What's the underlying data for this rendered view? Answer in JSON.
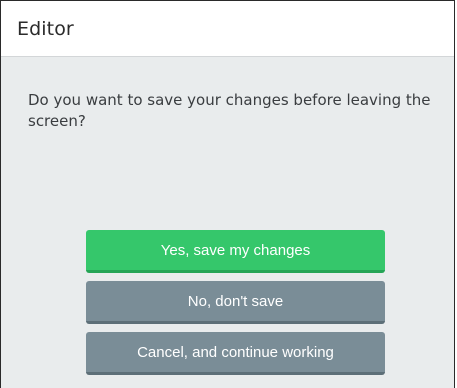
{
  "dialog": {
    "title": "Editor",
    "message": "Do you want to save your changes before leaving the screen?"
  },
  "buttons": {
    "save_label": "Yes, save my changes",
    "no_save_label": "No, don't save",
    "cancel_label": "Cancel, and continue working"
  },
  "colors": {
    "primary": "#35c76b",
    "secondary": "#7a8d97",
    "body_background": "#e9eced"
  }
}
